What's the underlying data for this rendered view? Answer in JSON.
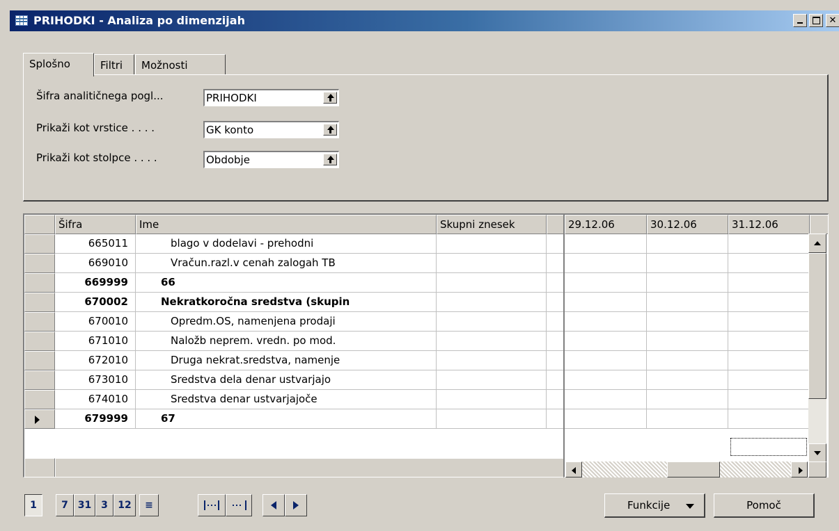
{
  "window": {
    "title": "PRIHODKI - Analiza po dimenzijah"
  },
  "tabs": [
    "Splošno",
    "Filtri",
    "Možnosti"
  ],
  "fields": [
    {
      "label": "Šifra analitičnega pogl...",
      "value": "PRIHODKI"
    },
    {
      "label": "Prikaži kot vrstice . . . .",
      "value": "GK konto"
    },
    {
      "label": "Prikaži kot stolpce . . . .",
      "value": "Obdobje"
    }
  ],
  "grid_left": {
    "headers": [
      "Šifra",
      "Ime",
      "Skupni znesek"
    ],
    "rows": [
      {
        "code": "665011",
        "name": "blago v dodelavi - prehodni",
        "bold": false
      },
      {
        "code": "669010",
        "name": "Vračun.razl.v cenah zalogah TB",
        "bold": false
      },
      {
        "code": "669999",
        "name": "66",
        "bold": true
      },
      {
        "code": "670002",
        "name": "Nekratkoročna sredstva (skupin",
        "bold": true
      },
      {
        "code": "670010",
        "name": "Opredm.OS, namenjena prodaji",
        "bold": false
      },
      {
        "code": "671010",
        "name": "Naložb neprem. vredn. po mod.",
        "bold": false
      },
      {
        "code": "672010",
        "name": "Druga nekrat.sredstva, namenje",
        "bold": false
      },
      {
        "code": "673010",
        "name": "Sredstva dela denar ustvarjajo",
        "bold": false
      },
      {
        "code": "674010",
        "name": "Sredstva denar ustvarjajoče",
        "bold": false
      },
      {
        "code": "679999",
        "name": "67",
        "bold": true
      }
    ]
  },
  "grid_right": {
    "headers": [
      "29.12.06",
      "30.12.06",
      "31.12.06"
    ]
  },
  "period_buttons": [
    "1",
    "7",
    "31",
    "3",
    "12",
    "≡"
  ],
  "buttons": {
    "functions": "Funkcije",
    "help": "Pomoč"
  }
}
